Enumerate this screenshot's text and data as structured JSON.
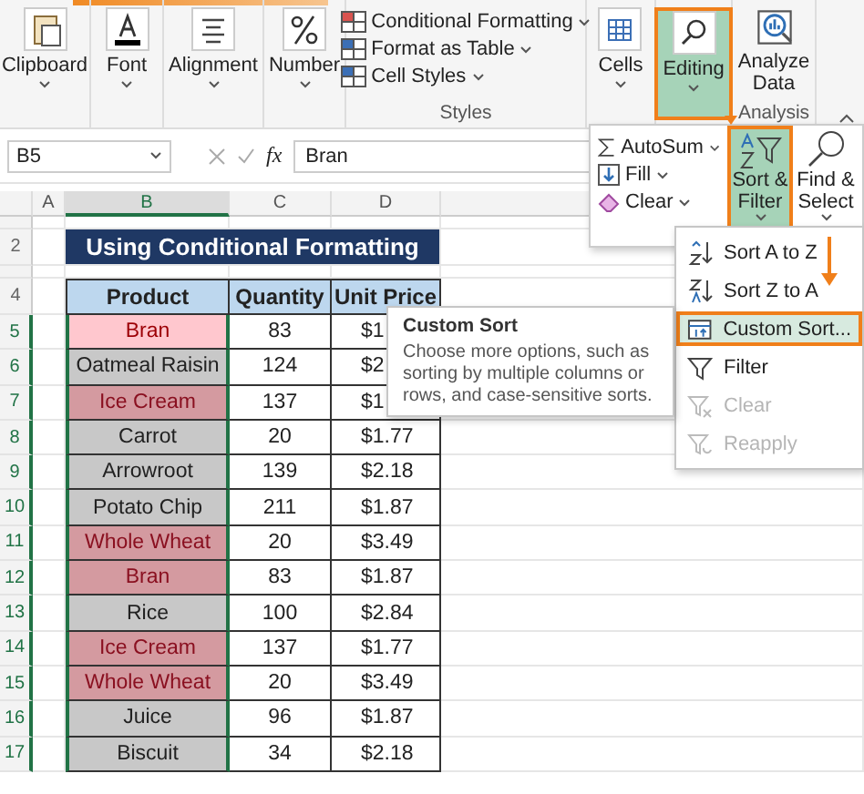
{
  "ribbon": {
    "groups": [
      {
        "kind": "large",
        "label": "Clipboard",
        "selected": false
      },
      {
        "kind": "large",
        "label": "Font",
        "selected": false
      },
      {
        "kind": "large",
        "label": "Alignment",
        "selected": false
      },
      {
        "kind": "large",
        "label": "Number",
        "selected": false
      },
      {
        "kind": "list",
        "items": [
          "Conditional Formatting",
          "Format as Table",
          "Cell Styles"
        ],
        "group_label": "Styles"
      },
      {
        "kind": "large",
        "label": "Cells",
        "selected": false
      },
      {
        "kind": "large",
        "label": "Editing",
        "selected": true
      },
      {
        "kind": "plain",
        "label": "Analyze Data",
        "group_label": "Analysis"
      }
    ]
  },
  "formula_bar": {
    "name_box": "B5",
    "function_label": "fx",
    "formula": "Bran"
  },
  "sheet": {
    "columns": [
      {
        "label": "A",
        "selected": false
      },
      {
        "label": "B",
        "selected": true
      },
      {
        "label": "C",
        "selected": false
      },
      {
        "label": "D",
        "selected": false
      }
    ],
    "title_row": "2",
    "title": "Using Conditional Formatting",
    "header_row": "4",
    "headers": [
      "Product",
      "Quantity",
      "Unit Price"
    ],
    "rows": [
      {
        "row": "5",
        "product": "Bran",
        "quantity": "83",
        "price": "$1",
        "highlighted": true,
        "selected": true,
        "active": true
      },
      {
        "row": "6",
        "product": "Oatmeal Raisin",
        "quantity": "124",
        "price": "$2",
        "highlighted": false,
        "selected": true,
        "active": false
      },
      {
        "row": "7",
        "product": "Ice Cream",
        "quantity": "137",
        "price": "$1",
        "highlighted": true,
        "selected": true,
        "active": false
      },
      {
        "row": "8",
        "product": "Carrot",
        "quantity": "20",
        "price": "$1.77",
        "highlighted": false,
        "selected": true,
        "active": false
      },
      {
        "row": "9",
        "product": "Arrowroot",
        "quantity": "139",
        "price": "$2.18",
        "highlighted": false,
        "selected": true,
        "active": false
      },
      {
        "row": "10",
        "product": "Potato Chip",
        "quantity": "211",
        "price": "$1.87",
        "highlighted": false,
        "selected": true,
        "active": false
      },
      {
        "row": "11",
        "product": "Whole Wheat",
        "quantity": "20",
        "price": "$3.49",
        "highlighted": true,
        "selected": true,
        "active": false
      },
      {
        "row": "12",
        "product": "Bran",
        "quantity": "83",
        "price": "$1.87",
        "highlighted": true,
        "selected": true,
        "active": false
      },
      {
        "row": "13",
        "product": "Rice",
        "quantity": "100",
        "price": "$2.84",
        "highlighted": false,
        "selected": true,
        "active": false
      },
      {
        "row": "14",
        "product": "Ice Cream",
        "quantity": "137",
        "price": "$1.77",
        "highlighted": true,
        "selected": true,
        "active": false
      },
      {
        "row": "15",
        "product": "Whole Wheat",
        "quantity": "20",
        "price": "$3.49",
        "highlighted": true,
        "selected": true,
        "active": false
      },
      {
        "row": "16",
        "product": "Juice",
        "quantity": "96",
        "price": "$1.87",
        "highlighted": false,
        "selected": true,
        "active": false
      },
      {
        "row": "17",
        "product": "Biscuit",
        "quantity": "34",
        "price": "$2.18",
        "highlighted": false,
        "selected": true,
        "active": false
      }
    ]
  },
  "editing_menu": {
    "items": [
      "AutoSum",
      "Fill",
      "Clear"
    ],
    "buttons": [
      {
        "label": "Sort & Filter",
        "selected": true
      },
      {
        "label": "Find & Select",
        "selected": false
      }
    ]
  },
  "sort_menu": {
    "items": [
      {
        "label": "Sort A to Z",
        "selected": false,
        "disabled": false
      },
      {
        "label": "Sort Z to A",
        "selected": false,
        "disabled": false
      },
      {
        "label": "Custom Sort...",
        "selected": true,
        "disabled": false
      },
      {
        "label": "Filter",
        "selected": false,
        "disabled": false
      },
      {
        "label": "Clear",
        "selected": false,
        "disabled": true
      },
      {
        "label": "Reapply",
        "selected": false,
        "disabled": true
      }
    ]
  },
  "tooltip": {
    "title": "Custom Sort",
    "text": "Choose more options, such as sorting by multiple columns or rows, and case-sensitive sorts."
  }
}
